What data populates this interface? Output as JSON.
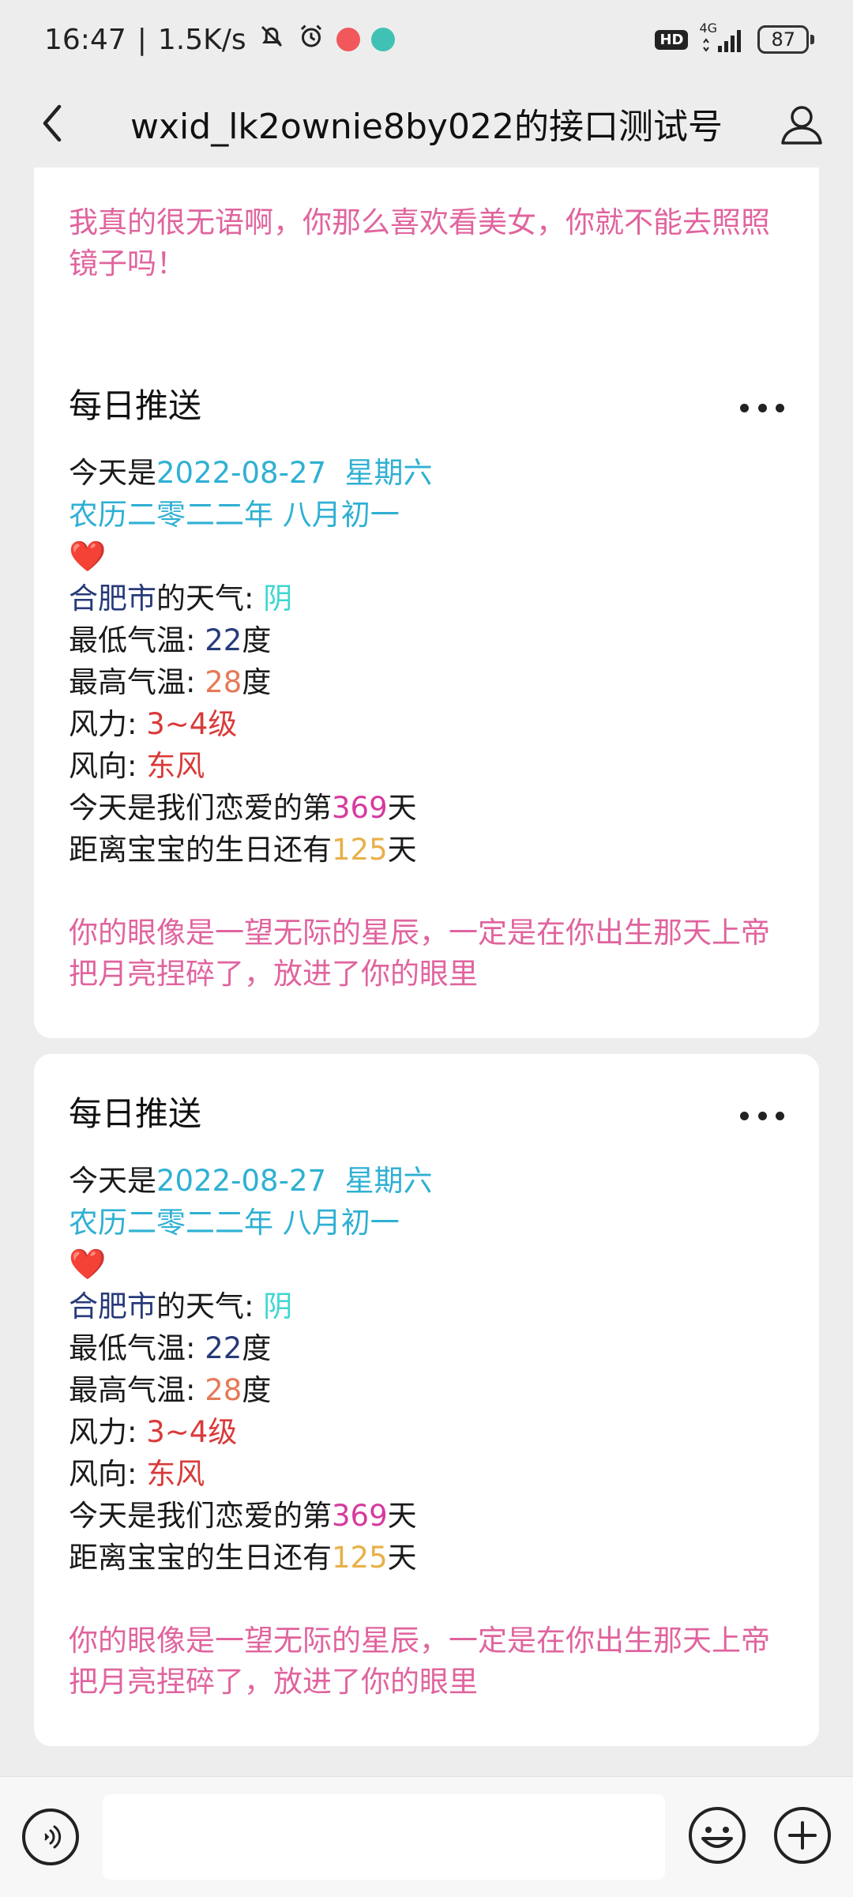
{
  "status_bar": {
    "time": "16:47",
    "net_speed": "1.5K/s",
    "network": "4G",
    "hd": "HD",
    "battery": "87"
  },
  "header": {
    "title": "wxid_lk2ownie8by022的接口测试号"
  },
  "top_card": {
    "quote": "我真的很无语啊，你那么喜欢看美女，你就不能去照照镜子吗！"
  },
  "messages": [
    {
      "title": "每日推送",
      "today_prefix": "今天是",
      "date": "2022-08-27",
      "weekday": "星期六",
      "lunar": "农历二零二二年 八月初一",
      "heart": "❤️",
      "city": "合肥市",
      "weather_label": "的天气: ",
      "weather": "阴",
      "min_temp_label": "最低气温: ",
      "min_temp": "22",
      "max_temp_label": "最高气温: ",
      "max_temp": "28",
      "degree": "度",
      "wind_power_label": "风力: ",
      "wind_power": "3~4级",
      "wind_dir_label": "风向: ",
      "wind_dir": "东风",
      "love_prefix": "今天是我们恋爱的第",
      "love_days": "369",
      "day_unit": "天",
      "birthday_prefix": "距离宝宝的生日还有",
      "birthday_days": "125",
      "quote": "你的眼像是一望无际的星辰，一定是在你出生那天上帝把月亮捏碎了，放进了你的眼里"
    },
    {
      "title": "每日推送",
      "today_prefix": "今天是",
      "date": "2022-08-27",
      "weekday": "星期六",
      "lunar": "农历二零二二年 八月初一",
      "heart": "❤️",
      "city": "合肥市",
      "weather_label": "的天气: ",
      "weather": "阴",
      "min_temp_label": "最低气温: ",
      "min_temp": "22",
      "max_temp_label": "最高气温: ",
      "max_temp": "28",
      "degree": "度",
      "wind_power_label": "风力: ",
      "wind_power": "3~4级",
      "wind_dir_label": "风向: ",
      "wind_dir": "东风",
      "love_prefix": "今天是我们恋爱的第",
      "love_days": "369",
      "day_unit": "天",
      "birthday_prefix": "距离宝宝的生日还有",
      "birthday_days": "125",
      "quote": "你的眼像是一望无际的星辰，一定是在你出生那天上帝把月亮捏碎了，放进了你的眼里"
    }
  ],
  "input": {
    "placeholder": ""
  },
  "colors": {
    "accent_pink": "#e0649e",
    "date_blue": "#2fb0d3",
    "city_navy": "#273a7a",
    "weather_cyan": "#3dd7d1",
    "max_temp_orange": "#e57a57",
    "wind_red": "#d93a3a",
    "love_magenta": "#d63a9e",
    "birthday_gold": "#e8b04a"
  }
}
